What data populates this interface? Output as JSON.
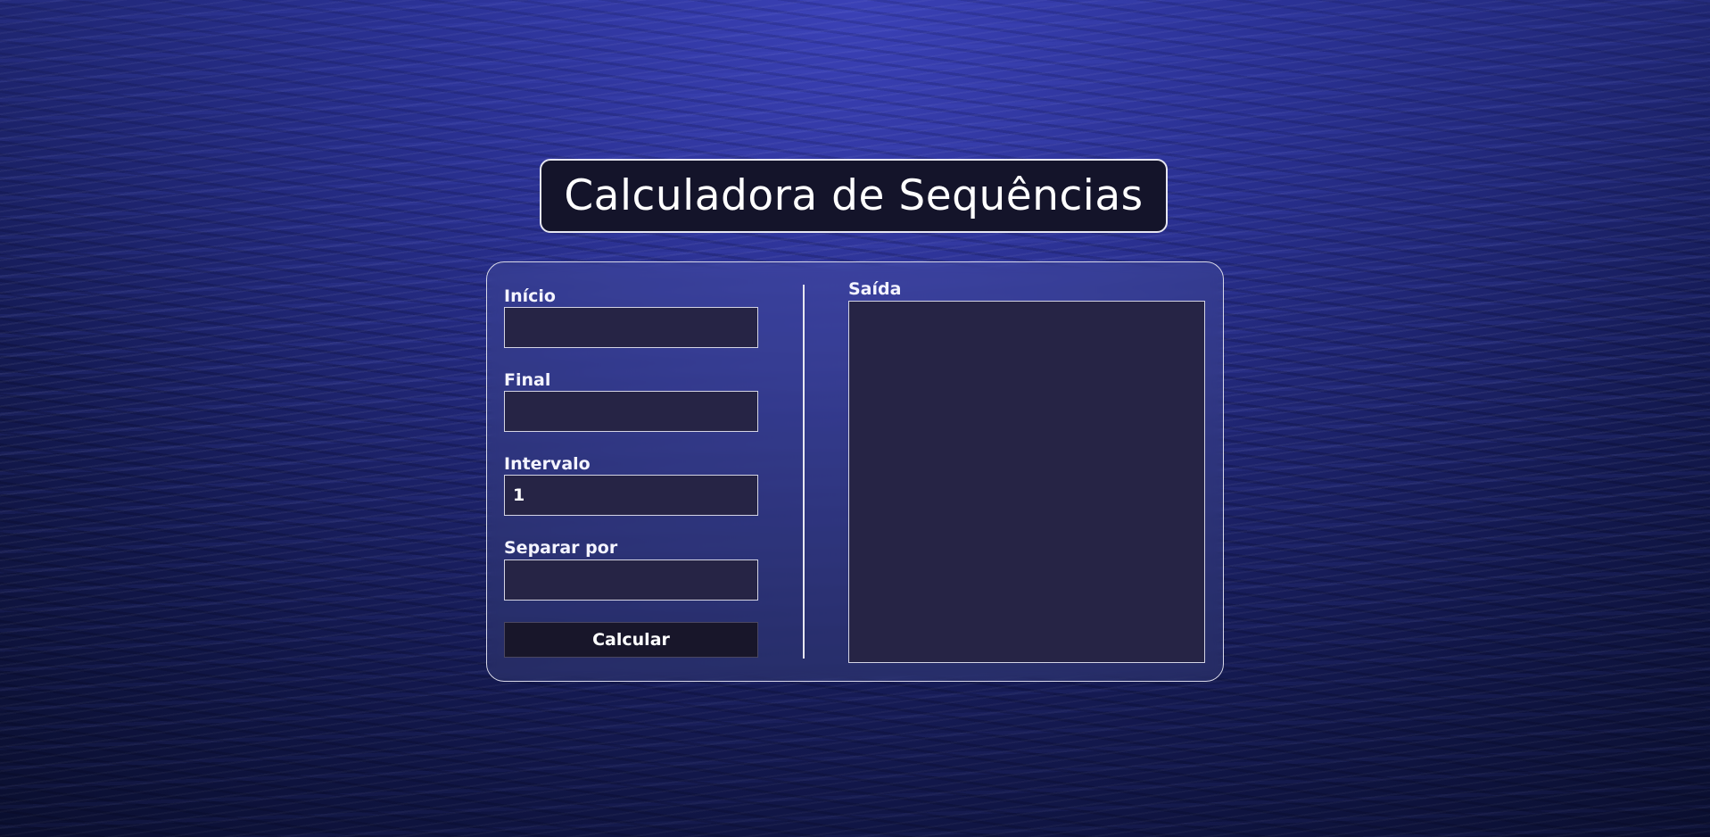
{
  "app": {
    "title": "Calculadora de Sequências"
  },
  "form": {
    "start": {
      "label": "Início",
      "value": ""
    },
    "end": {
      "label": "Final",
      "value": ""
    },
    "interval": {
      "label": "Intervalo",
      "value": "1"
    },
    "separator": {
      "label": "Separar por",
      "value": ""
    },
    "calculate_label": "Calcular"
  },
  "output": {
    "label": "Saída",
    "value": ""
  },
  "colors": {
    "title_bg": "#14142a",
    "input_bg": "#262445",
    "button_bg": "#18162a",
    "border": "#d4d4e4",
    "text": "#ffffff"
  }
}
